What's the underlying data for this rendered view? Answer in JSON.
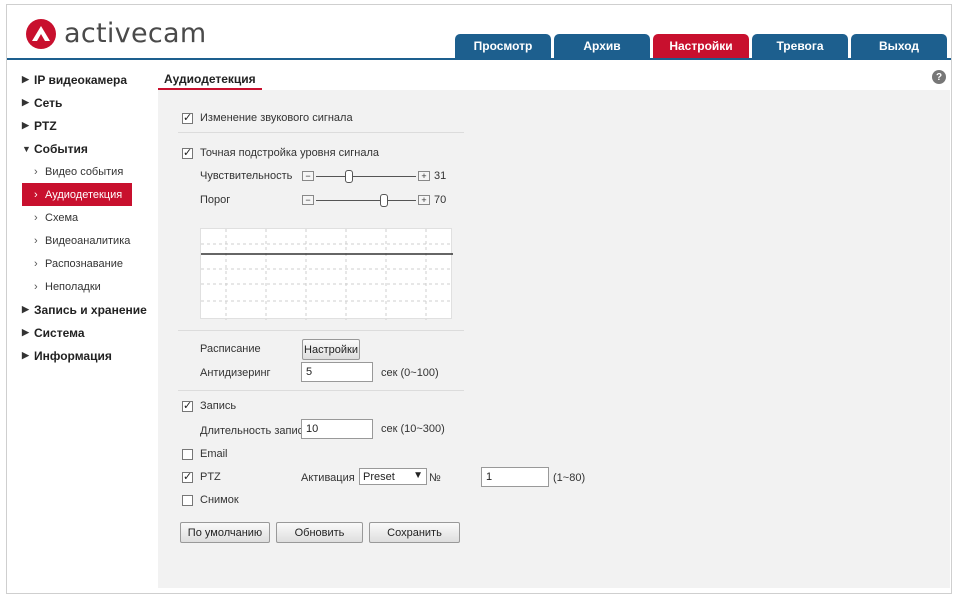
{
  "brand": {
    "name": "activecam",
    "logo_icon": "activecam-logo-icon",
    "accent": "#c8102e",
    "nav_color": "#1d5f8e"
  },
  "topnav": {
    "tabs": [
      {
        "label": "Просмотр",
        "active": false
      },
      {
        "label": "Архив",
        "active": false
      },
      {
        "label": "Настройки",
        "active": true
      },
      {
        "label": "Тревога",
        "active": false
      },
      {
        "label": "Выход",
        "active": false
      }
    ]
  },
  "sidebar": {
    "ip_camera": "IP видеокамера",
    "network": "Сеть",
    "ptz": "PTZ",
    "events": "События",
    "event_items": [
      "Видео события",
      "Аудиодетекция",
      "Схема",
      "Видеоаналитика",
      "Распознавание",
      "Неполадки"
    ],
    "recording": "Запись и хранение",
    "system": "Система",
    "info": "Информация"
  },
  "content": {
    "title": "Аудиодетекция",
    "help_icon": "question-icon",
    "sound_change_label": "Изменение звукового сигнала",
    "sound_change_checked": true,
    "fine_tune_label": "Точная подстройка уровня сигнала",
    "fine_tune_checked": true,
    "sensitivity": {
      "label": "Чувствительность",
      "value": "31",
      "min": 0,
      "max": 100
    },
    "threshold": {
      "label": "Порог",
      "value": "70",
      "min": 0,
      "max": 100
    },
    "schedule_label": "Расписание",
    "schedule_button": "Настройки",
    "antidither_label": "Антидизеринг",
    "antidither_value": "5",
    "antidither_unit": "сек (0~100)",
    "record_label": "Запись",
    "record_checked": true,
    "record_duration_label": "Длительность записи",
    "record_duration_value": "10",
    "record_duration_unit": "сек (10~300)",
    "email_label": "Email",
    "email_checked": false,
    "ptz_label": "PTZ",
    "ptz_checked": true,
    "activation_label": "Активация",
    "activation_value": "Preset",
    "number_label": "№",
    "preset_number": "1",
    "preset_range": "(1~80)",
    "snapshot_label": "Снимок",
    "snapshot_checked": false,
    "default_button": "По умолчанию",
    "refresh_button": "Обновить",
    "save_button": "Сохранить"
  }
}
